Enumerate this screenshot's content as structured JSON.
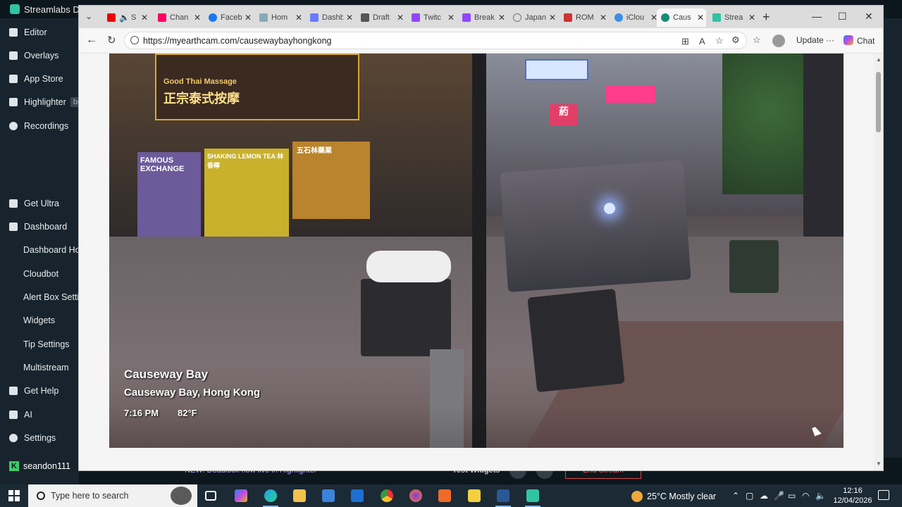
{
  "streamlabs": {
    "title": "Streamlabs De",
    "sidebar": [
      {
        "label": "Editor",
        "icon": "editor-icon"
      },
      {
        "label": "Overlays",
        "icon": "overlays-icon"
      },
      {
        "label": "App Store",
        "icon": "app-store-icon"
      },
      {
        "label": "Highlighter",
        "icon": "highlighter-icon",
        "badge": "be"
      },
      {
        "label": "Recordings",
        "icon": "recordings-icon"
      },
      {
        "label": "Get Ultra",
        "icon": "ultra-icon"
      },
      {
        "label": "Dashboard",
        "icon": "dashboard-icon"
      },
      {
        "label": "Dashboard Hon"
      },
      {
        "label": "Cloudbot"
      },
      {
        "label": "Alert Box Settin"
      },
      {
        "label": "Widgets"
      },
      {
        "label": "Tip Settings"
      },
      {
        "label": "Multistream"
      },
      {
        "label": "Get Help",
        "icon": "help-icon"
      },
      {
        "label": "AI",
        "icon": "ai-icon"
      },
      {
        "label": "Settings",
        "icon": "settings-icon"
      }
    ],
    "username": "seandon111",
    "user_badge": "K",
    "news": "NEW: Deadlock now live in Highlighter",
    "test_widgets": "Test Widgets",
    "end_stream": "End Stream"
  },
  "browser": {
    "tabs": [
      {
        "label": "S",
        "color": "#e00"
      },
      {
        "label": "Chan",
        "color": "#f06"
      },
      {
        "label": "Faceb",
        "color": "#1877f2"
      },
      {
        "label": "Hom",
        "color": "#8ab"
      },
      {
        "label": "Dashb",
        "color": "#6a7cff"
      },
      {
        "label": "Draft",
        "color": "#555"
      },
      {
        "label": "Twitc",
        "color": "#9146ff"
      },
      {
        "label": "Break",
        "color": "#9146ff"
      },
      {
        "label": "Japan",
        "color": "#777"
      },
      {
        "label": "ROM",
        "color": "#c33"
      },
      {
        "label": "iClou",
        "color": "#3a8ee6"
      },
      {
        "label": "Caus",
        "color": "#1b8a7a",
        "active": true
      },
      {
        "label": "Strea",
        "color": "#31c3a2"
      }
    ],
    "url": "https://myearthcam.com/causewaybayhongkong",
    "update_label": "Update",
    "chat_label": "Chat"
  },
  "video": {
    "title": "Causeway Bay",
    "location": "Causeway Bay, Hong Kong",
    "time": "7:16 PM",
    "temperature": "82°F",
    "signs": [
      "Good Thai Massage",
      "正宗泰式按摩",
      "FAMOUS EXCHANGE",
      "SHAKING LEMON TEA 林香檸",
      "五石林藥業",
      "葯"
    ]
  },
  "taskbar": {
    "search_placeholder": "Type here to search",
    "weather": "25°C  Mostly clear",
    "time": "12:16",
    "date": "12/04/2026",
    "apps": [
      "copilot-icon",
      "edge-icon",
      "file-explorer-icon",
      "store-icon",
      "outlook-icon",
      "chrome-icon",
      "firefox-icon",
      "brave-icon",
      "sticky-notes-icon",
      "word-icon",
      "streamlabs-icon"
    ]
  }
}
